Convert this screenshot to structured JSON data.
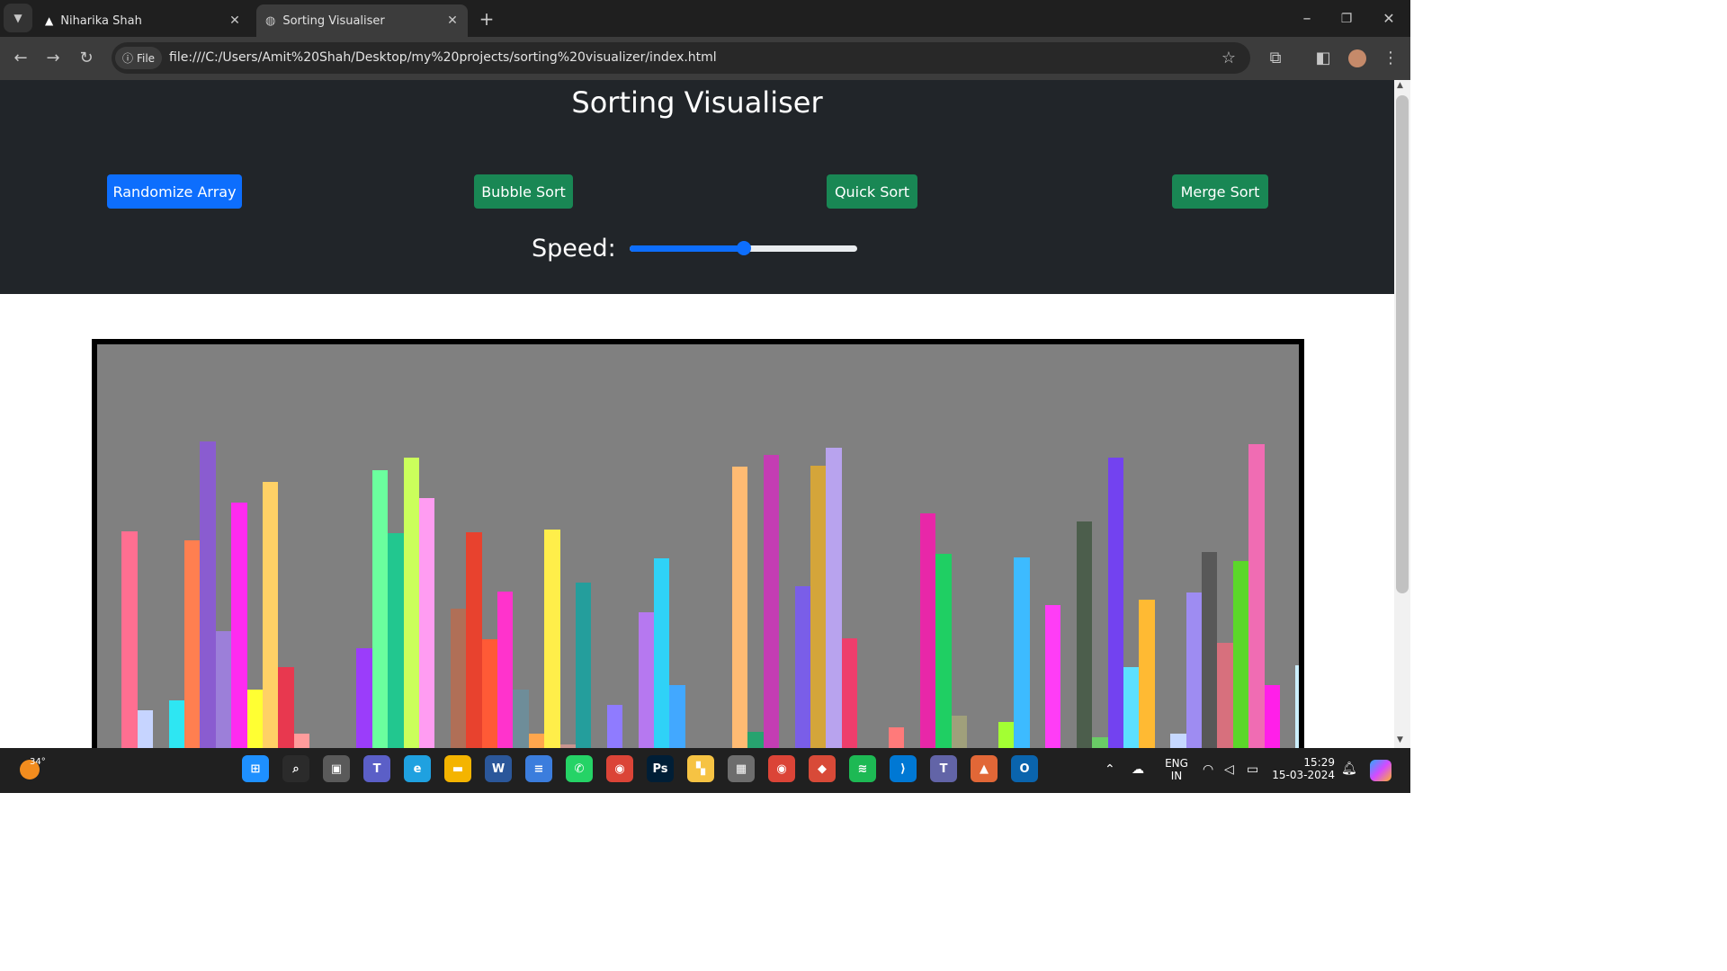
{
  "browser": {
    "tabs": [
      {
        "title": "Niharika Shah",
        "active": false
      },
      {
        "title": "Sorting Visualiser",
        "active": true
      }
    ],
    "new_tab_label": "+",
    "url_badge": "File",
    "url": "file:///C:/Users/Amit%20Shah/Desktop/my%20projects/sorting%20visualizer/index.html"
  },
  "page": {
    "title": "Sorting Visualiser",
    "buttons": {
      "randomize": "Randomize Array",
      "bubble": "Bubble Sort",
      "quick": "Quick Sort",
      "merge": "Merge Sort"
    },
    "speed_label": "Speed:",
    "speed_value": 0.5
  },
  "visualizer": {
    "bars": [
      {
        "h": 1,
        "c": "#3fae4f"
      },
      {
        "h": 251,
        "c": "#ff6f91"
      },
      {
        "h": 52,
        "c": "#c6d4ff"
      },
      {
        "h": 0,
        "c": "#808080"
      },
      {
        "h": 63,
        "c": "#2ee6f2"
      },
      {
        "h": 241,
        "c": "#ff7f50"
      },
      {
        "h": 351,
        "c": "#8a5cd0"
      },
      {
        "h": 140,
        "c": "#9c7fd9"
      },
      {
        "h": 283,
        "c": "#ff2bf0"
      },
      {
        "h": 75,
        "c": "#ffff33"
      },
      {
        "h": 306,
        "c": "#ffd166"
      },
      {
        "h": 100,
        "c": "#e8384f"
      },
      {
        "h": 26,
        "c": "#ff9c9c"
      },
      {
        "h": 0,
        "c": "#808080"
      },
      {
        "h": 0,
        "c": "#808080"
      },
      {
        "h": 0,
        "c": "#808080"
      },
      {
        "h": 121,
        "c": "#9b3dfa"
      },
      {
        "h": 319,
        "c": "#6bff9e"
      },
      {
        "h": 249,
        "c": "#22c78f"
      },
      {
        "h": 333,
        "c": "#cbff5b"
      },
      {
        "h": 288,
        "c": "#ff9cf2"
      },
      {
        "h": 0,
        "c": "#808080"
      },
      {
        "h": 165,
        "c": "#b06f57"
      },
      {
        "h": 250,
        "c": "#e8422e"
      },
      {
        "h": 131,
        "c": "#ff5a36"
      },
      {
        "h": 184,
        "c": "#ff33cc"
      },
      {
        "h": 75,
        "c": "#6e8d99"
      },
      {
        "h": 26,
        "c": "#ffa64d"
      },
      {
        "h": 253,
        "c": "#ffee4a"
      },
      {
        "h": 14,
        "c": "#c9958f"
      },
      {
        "h": 194,
        "c": "#249e9c"
      },
      {
        "h": 0,
        "c": "#808080"
      },
      {
        "h": 58,
        "c": "#8f7bff"
      },
      {
        "h": 0,
        "c": "#808080"
      },
      {
        "h": 161,
        "c": "#b678f0"
      },
      {
        "h": 221,
        "c": "#2fd2f7"
      },
      {
        "h": 80,
        "c": "#42a8ff"
      },
      {
        "h": 4,
        "c": "#3346cc"
      },
      {
        "h": 0,
        "c": "#808080"
      },
      {
        "h": 0,
        "c": "#808080"
      },
      {
        "h": 323,
        "c": "#ffbb73"
      },
      {
        "h": 28,
        "c": "#27a36f"
      },
      {
        "h": 336,
        "c": "#c43db3"
      },
      {
        "h": 0,
        "c": "#808080"
      },
      {
        "h": 190,
        "c": "#7a5ee8"
      },
      {
        "h": 324,
        "c": "#d4a53a"
      },
      {
        "h": 344,
        "c": "#b8a3ee"
      },
      {
        "h": 132,
        "c": "#ee3e6c"
      },
      {
        "h": 0,
        "c": "#808080"
      },
      {
        "h": 0,
        "c": "#808080"
      },
      {
        "h": 33,
        "c": "#ff7a7a"
      },
      {
        "h": 0,
        "c": "#808080"
      },
      {
        "h": 271,
        "c": "#e827a8"
      },
      {
        "h": 226,
        "c": "#1fcf63"
      },
      {
        "h": 46,
        "c": "#a0a07b"
      },
      {
        "h": 0,
        "c": "#808080"
      },
      {
        "h": 0,
        "c": "#808080"
      },
      {
        "h": 39,
        "c": "#a3ff33"
      },
      {
        "h": 222,
        "c": "#3dbbff"
      },
      {
        "h": 0,
        "c": "#808080"
      },
      {
        "h": 169,
        "c": "#ff3df6"
      },
      {
        "h": 0,
        "c": "#808080"
      },
      {
        "h": 262,
        "c": "#4c5e4c"
      },
      {
        "h": 22,
        "c": "#6acc66"
      },
      {
        "h": 333,
        "c": "#7342f0"
      },
      {
        "h": 100,
        "c": "#5ce0ff"
      },
      {
        "h": 175,
        "c": "#ffba33"
      },
      {
        "h": 0,
        "c": "#808080"
      },
      {
        "h": 26,
        "c": "#c6d8ff"
      },
      {
        "h": 183,
        "c": "#9e8cf2"
      },
      {
        "h": 228,
        "c": "#585858"
      },
      {
        "h": 127,
        "c": "#d7707d"
      },
      {
        "h": 218,
        "c": "#5bd72a"
      },
      {
        "h": 348,
        "c": "#f06cb3"
      },
      {
        "h": 80,
        "c": "#ff1fe9"
      },
      {
        "h": 5,
        "c": "#9ee86b"
      },
      {
        "h": 102,
        "c": "#ccefff"
      }
    ]
  },
  "taskbar": {
    "weather_temp": "34°",
    "lang_line1": "ENG",
    "lang_line2": "IN",
    "time": "15:29",
    "date": "15-03-2024",
    "apps": [
      "start-icon",
      "search-icon",
      "task-view-icon",
      "teams-icon",
      "edge-icon",
      "file-explorer-icon",
      "word-icon",
      "notepad-icon",
      "whatsapp-icon",
      "chrome-icon",
      "photoshop-icon",
      "files-icon",
      "calculator-icon",
      "chrome-active-icon",
      "git-icon",
      "spotify-icon",
      "vscode-icon",
      "teams-work-icon",
      "matlab-icon",
      "outlook-icon"
    ]
  }
}
